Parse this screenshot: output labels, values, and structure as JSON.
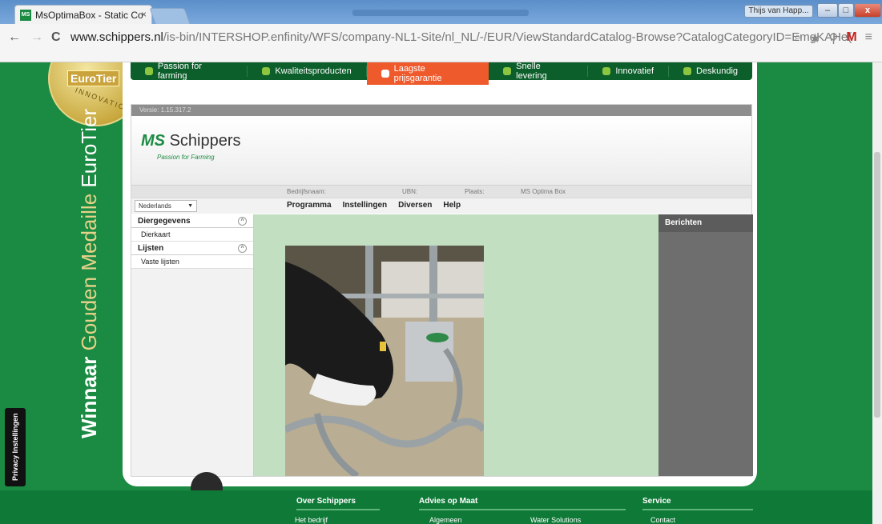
{
  "browser": {
    "tab_title": "MsOptimaBox - Static Co",
    "tab_close": "×",
    "favicon_text": "MS",
    "user_button": "Thijs van Happ...",
    "url_host": "www.schippers.nl",
    "url_path": "/is-bin/INTERSHOP.enfinity/WFS/company-NL1-Site/nl_NL/-/EUR/ViewStandardCatalog-Browse?CatalogCategoryID=EmgKAHe("
  },
  "site_nav": {
    "items": [
      {
        "label": "Passion for farming"
      },
      {
        "label": "Kwaliteitsproducten"
      },
      {
        "label": "Laagste prijsgarantie"
      },
      {
        "label": "Snelle levering"
      },
      {
        "label": "Innovatief"
      },
      {
        "label": "Deskundig"
      }
    ]
  },
  "medal": {
    "brand": "EuroTier",
    "text": "INNOVATION"
  },
  "side_banner": {
    "bold": "Winnaar",
    "gold": "Gouden Medaille",
    "rest": "EuroTier"
  },
  "privacy": "Privacy Instellingen",
  "app": {
    "version": "Versie: 1.15.317.2",
    "logo_ms": "MS",
    "logo_name": "Schippers",
    "logo_tagline": "Passion for Farming",
    "info": {
      "company_label": "Bedrijfsnaam:",
      "ubn_label": "UBN:",
      "place_label": "Plaats:",
      "product": "MS Optima Box"
    },
    "language": "Nederlands",
    "menus": [
      "Programma",
      "Instellingen",
      "Diversen",
      "Help"
    ],
    "sections": [
      {
        "title": "Diergegevens",
        "items": [
          "Dierkaart"
        ]
      },
      {
        "title": "Lijsten",
        "items": [
          "Vaste lijsten"
        ]
      }
    ],
    "messages_title": "Berichten"
  },
  "footer": {
    "cols": [
      {
        "title": "Over Schippers",
        "link": "Het bedrijf"
      },
      {
        "title": "Advies op Maat",
        "link": "Algemeen",
        "link2": "Water Solutions"
      },
      {
        "title": "Service",
        "link": "Contact"
      }
    ]
  },
  "colors": {
    "brand_green": "#1b8a42",
    "accent_orange": "#ee5a2c",
    "dark_green": "#0c5e2a"
  }
}
